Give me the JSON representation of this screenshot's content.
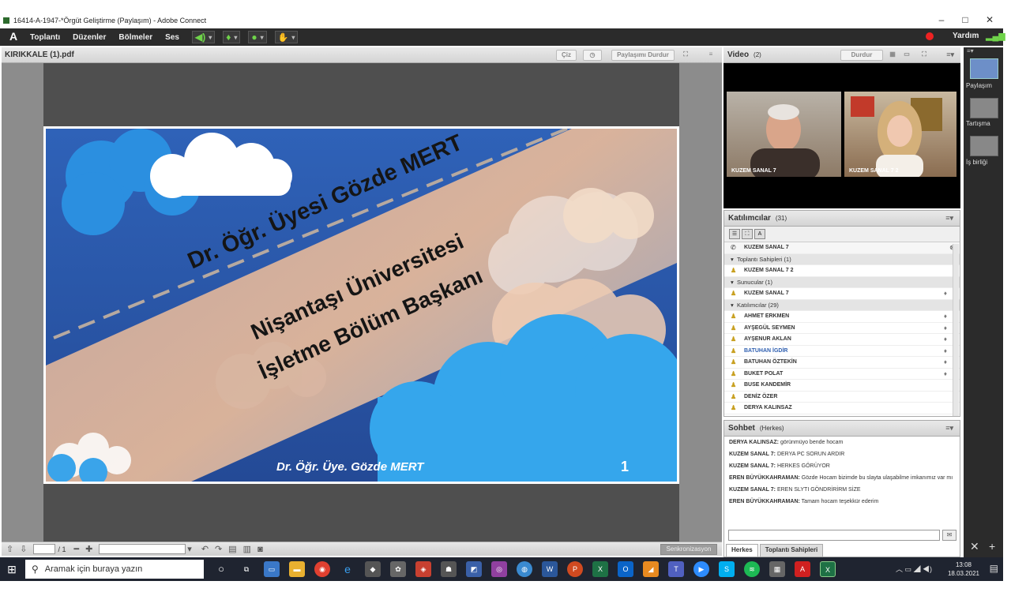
{
  "window": {
    "title": "16414-A-1947-*Örgüt Geliştirme (Paylaşım) - Adobe Connect",
    "minimize": "–",
    "maximize": "□",
    "close": "✕"
  },
  "menu": {
    "logo_text": "A",
    "items": [
      "Toplantı",
      "Düzenler",
      "Bölmeler",
      "Ses"
    ],
    "help": "Yardım"
  },
  "share_pod": {
    "title": "KIRIKKALE (1).pdf",
    "btn_draw": "Çiz",
    "btn_stop": "Paylaşımı Durdur",
    "slide": {
      "line1": "Dr. Öğr. Üyesi Gözde MERT",
      "line2": "Nişantaşı Üniversitesi",
      "line3": "İşletme Bölüm Başkanı",
      "footer": "Dr. Öğr. Üye. Gözde MERT",
      "page_number": "1"
    },
    "page_total": "/ 1",
    "sync_label": "Senkronizasyon"
  },
  "video_pod": {
    "title": "Video",
    "count": "(2)",
    "btn_stop": "Durdur",
    "feeds": [
      {
        "name": "KUZEM SANAL 7"
      },
      {
        "name": "KUZEM SANAL 7 2"
      }
    ]
  },
  "participants_pod": {
    "title": "Katılımcılar",
    "count": "(31)",
    "current_user": "KUZEM SANAL 7",
    "groups": [
      {
        "label": "Toplantı Sahipleri (1)",
        "members": [
          "KUZEM SANAL 7 2"
        ]
      },
      {
        "label": "Sunucular (1)",
        "members": [
          "KUZEM SANAL 7"
        ]
      },
      {
        "label": "Katılımcılar (29)",
        "members": [
          "AHMET ERKMEN",
          "AYŞEGÜL SEYMEN",
          "AYŞENUR AKLAN",
          "BATUHAN İGDİR",
          "BATUHAN ÖZTEKİN",
          "BUKET POLAT",
          "BUSE KANDEMİR",
          "DENİZ ÖZER",
          "DERYA KALINSAZ"
        ]
      }
    ]
  },
  "chat_pod": {
    "title": "Sohbet",
    "scope": "(Herkes)",
    "messages": [
      {
        "author": "DERYA KALINSAZ:",
        "text": "görünmüyo bende hocam"
      },
      {
        "author": "KUZEM SANAL 7:",
        "text": "DERYA PC SORUN ARDIR"
      },
      {
        "author": "KUZEM SANAL 7:",
        "text": "HERKES GÖRÜYOR"
      },
      {
        "author": "EREN BÜYÜKKAHRAMAN:",
        "text": "Gözde Hocam bizimde bu slayta ulaşabilme imkanımız var mı"
      },
      {
        "author": "KUZEM SANAL 7:",
        "text": "EREN SLYTI GÖNDRİRİRM SİZE"
      },
      {
        "author": "EREN BÜYÜKKAHRAMAN:",
        "text": "Tamam hocam teşekkür ederim"
      }
    ],
    "tabs": [
      "Herkes",
      "Toplantı Sahipleri"
    ]
  },
  "layouts": [
    {
      "label": "Paylaşım"
    },
    {
      "label": "Tartışma"
    },
    {
      "label": "İş birliği"
    }
  ],
  "taskbar": {
    "search_placeholder": "Aramak için buraya yazın",
    "time": "13:08",
    "date": "18.03.2021"
  }
}
